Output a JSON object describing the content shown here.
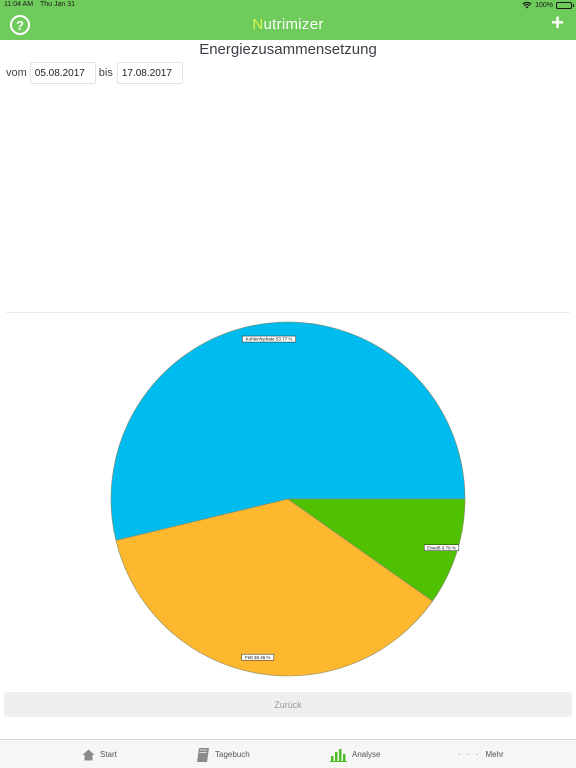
{
  "status_bar": {
    "time": "11:04 AM",
    "date": "Thu Jan 31",
    "battery": "100%"
  },
  "header": {
    "title_first": "N",
    "title_rest": "utrimizer"
  },
  "page": {
    "title": "Energiezusammensetzung",
    "from_label": "vom",
    "from_value": "05.08.2017",
    "to_label": "bis",
    "to_value": "17.08.2017",
    "back_label": "Zurück"
  },
  "chart_data": {
    "type": "pie",
    "slices": [
      {
        "label": "Kohlenhydrate 53.77 %",
        "value": 53.77,
        "color": "#00bbed"
      },
      {
        "label": "Fett 36.46 %",
        "value": 36.46,
        "color": "#fdb830"
      },
      {
        "label": "Eiweiß 9.78 %",
        "value": 9.78,
        "color": "#50c100"
      }
    ]
  },
  "tabs": [
    {
      "label": "Start",
      "icon": "house-icon"
    },
    {
      "label": "Tagebuch",
      "icon": "book-icon"
    },
    {
      "label": "Analyse",
      "icon": "bar-chart-icon",
      "active_color": "#4cbd24"
    },
    {
      "label": "Mehr",
      "icon": "more-dots-icon",
      "dots": "· · ·"
    }
  ]
}
